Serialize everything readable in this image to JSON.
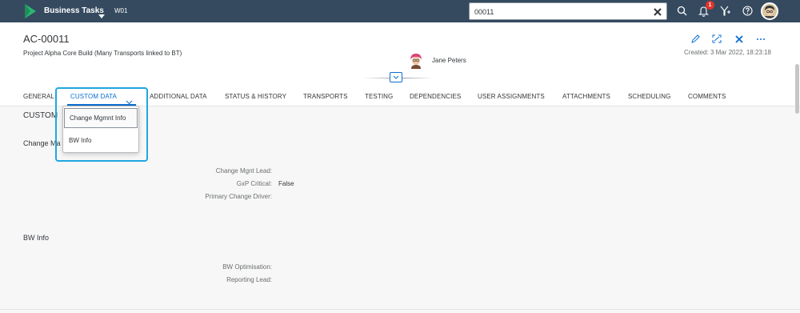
{
  "shell": {
    "app_title": "Business Tasks",
    "app_subtitle": "W01",
    "search_value": "00011",
    "notification_count": "1"
  },
  "header": {
    "object_id": "AC-00011",
    "description": "Project Alpha Core Build (Many Transports linked to BT)",
    "created": "Created: 3 Mar 2022, 18:23:18",
    "person_name": "Jane Peters"
  },
  "tabs": [
    {
      "label": "GENERAL"
    },
    {
      "label": "CUSTOM DATA"
    },
    {
      "label": "ADDITIONAL DATA"
    },
    {
      "label": "STATUS & HISTORY"
    },
    {
      "label": "TRANSPORTS"
    },
    {
      "label": "TESTING"
    },
    {
      "label": "DEPENDENCIES"
    },
    {
      "label": "USER ASSIGNMENTS"
    },
    {
      "label": "ATTACHMENTS"
    },
    {
      "label": "SCHEDULING"
    },
    {
      "label": "COMMENTS"
    }
  ],
  "dropdown": {
    "items": [
      {
        "label": "Change Mgmnt Info"
      },
      {
        "label": "BW Info"
      }
    ]
  },
  "content": {
    "section_title": "CUSTOM",
    "change_subtitle": "Change Ma",
    "change_fields": [
      {
        "label": "Change Mgnt Lead:",
        "value": ""
      },
      {
        "label": "GxP Critical:",
        "value": "False"
      },
      {
        "label": "Primary Change Driver:",
        "value": ""
      }
    ],
    "bw_subtitle": "BW Info",
    "bw_fields": [
      {
        "label": "BW Optimisation:",
        "value": ""
      },
      {
        "label": "Reporting Lead:",
        "value": ""
      }
    ]
  },
  "colors": {
    "shell_bg": "#354a5f",
    "accent": "#0a6ed1",
    "highlight": "#1ea7e0",
    "badge": "#e0342c"
  }
}
